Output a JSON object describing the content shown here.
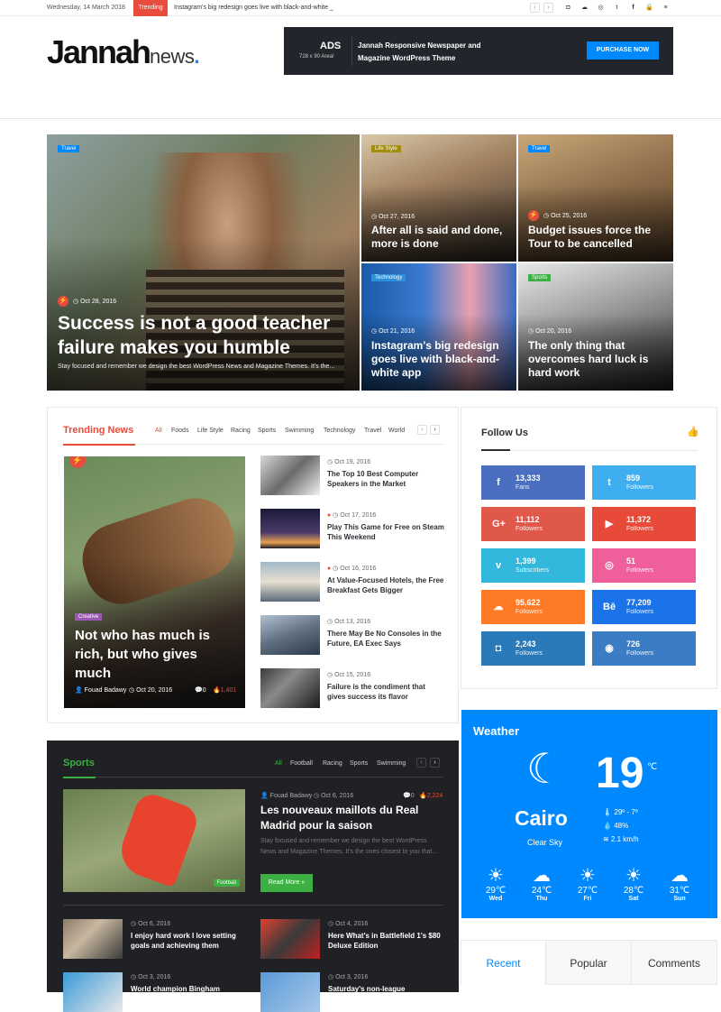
{
  "topbar": {
    "date": "Wednesday, 14 March 2018",
    "trending_label": "Trending",
    "ticker": "Instagram's big redesign goes live with black-and-white _",
    "prev": "‹",
    "next": "›"
  },
  "header": {
    "logo_main": "Jannah",
    "logo_news": "news",
    "logo_dot": ".",
    "ad": {
      "ads": "ADS",
      "size": "728 x 90 Area!",
      "text": "Jannah Responsive Newspaper and Magazine WordPress Theme",
      "button": "PURCHASE NOW"
    }
  },
  "hero": {
    "main": {
      "category": "Travel",
      "date": "Oct 28, 2016",
      "title": "Success is not a good teacher failure makes you humble",
      "excerpt": "Stay focused and remember we design the best WordPress News and Magazine Themes. It's the..."
    },
    "tiles": [
      {
        "category": "Life Style",
        "date": "Oct 27, 2016",
        "title": "After all is said and done, more is done"
      },
      {
        "category": "Travel",
        "date": "Oct 25, 2016",
        "title": "Budget issues force the Tour to be cancelled"
      },
      {
        "category": "Technology",
        "date": "Oct 21, 2016",
        "title": "Instagram's big redesign goes live with black-and-white app"
      },
      {
        "category": "Sports",
        "date": "Oct 20, 2016",
        "title": "The only thing that overcomes hard luck is hard work"
      }
    ]
  },
  "trending": {
    "title": "Trending News",
    "tabs": [
      "All",
      "Foods",
      "Life Style",
      "Racing",
      "Sports",
      "Swimming",
      "Technology",
      "Travel",
      "World"
    ],
    "featured": {
      "category": "Creative",
      "title": "Not who has much is rich, but who gives much",
      "author": "Fouad Badawy",
      "date": "Oct 20, 2016",
      "comments": "0",
      "views": "1,401"
    },
    "items": [
      {
        "date": "Oct 19, 2016",
        "title": "The Top 10 Best Computer Speakers in the Market"
      },
      {
        "date": "Oct 17, 2016",
        "title": "Play This Game for Free on Steam This Weekend"
      },
      {
        "date": "Oct 16, 2016",
        "title": "At Value-Focused Hotels, the Free Breakfast Gets Bigger"
      },
      {
        "date": "Oct 13, 2016",
        "title": "There May Be No Consoles in the Future, EA Exec Says"
      },
      {
        "date": "Oct 15, 2016",
        "title": "Failure is the condiment that gives success its flavor"
      }
    ]
  },
  "follow": {
    "title": "Follow Us",
    "networks": [
      {
        "icon": "f",
        "name": "facebook-icon",
        "count": "13,333",
        "label": "Fans",
        "color": "#4a6fc0"
      },
      {
        "icon": "t",
        "name": "twitter-icon",
        "count": "859",
        "label": "Followers",
        "color": "#3eaef0"
      },
      {
        "icon": "G+",
        "name": "google-plus-icon",
        "count": "11,112",
        "label": "Followers",
        "color": "#e0584a"
      },
      {
        "icon": "▶",
        "name": "youtube-icon",
        "count": "11,372",
        "label": "Followers",
        "color": "#e84a3a"
      },
      {
        "icon": "v",
        "name": "vimeo-icon",
        "count": "1,399",
        "label": "Subscribers",
        "color": "#32b8dc"
      },
      {
        "icon": "◎",
        "name": "dribbble-icon",
        "count": "51",
        "label": "Followers",
        "color": "#ef5f9c"
      },
      {
        "icon": "☁",
        "name": "soundcloud-icon",
        "count": "95,622",
        "label": "Followers",
        "color": "#ff7a26"
      },
      {
        "icon": "Bē",
        "name": "behance-icon",
        "count": "77,209",
        "label": "Followers",
        "color": "#1a73e8"
      },
      {
        "icon": "◘",
        "name": "instagram-icon",
        "count": "2,243",
        "label": "Followers",
        "color": "#2a79b8"
      },
      {
        "icon": "◉",
        "name": "github-icon",
        "count": "726",
        "label": "Followers",
        "color": "#3b7dc4"
      }
    ]
  },
  "weather": {
    "title": "Weather",
    "temp": "19",
    "unit": "℃",
    "range": "29º - 7º",
    "humidity": "48%",
    "wind": "2.1 km/h",
    "city": "Cairo",
    "desc": "Clear Sky",
    "forecast": [
      {
        "temp": "29℃",
        "day": "Wed",
        "icon": "☀"
      },
      {
        "temp": "24℃",
        "day": "Thu",
        "icon": "☁"
      },
      {
        "temp": "27℃",
        "day": "Fri",
        "icon": "☀"
      },
      {
        "temp": "28℃",
        "day": "Sat",
        "icon": "☀"
      },
      {
        "temp": "31℃",
        "day": "Sun",
        "icon": "☁"
      }
    ]
  },
  "sports": {
    "title": "Sports",
    "tabs": [
      "All",
      "Football",
      "Racing",
      "Sports",
      "Swimming"
    ],
    "featured": {
      "author": "Fouad Badawy",
      "date": "Oct 6, 2016",
      "comments": "0",
      "views": "2,224",
      "title": "Les nouveaux maillots du Real Madrid pour la saison",
      "excerpt": "Stay focused and remember we design the best WordPress News and Magazine Themes. It's the ones closest to you that...",
      "category": "Football",
      "read_more": "Read More »"
    },
    "items": [
      {
        "date": "Oct 6, 2016",
        "title": "I enjoy hard work I love setting goals and achieving them"
      },
      {
        "date": "Oct 4, 2016",
        "title": "Here What's in Battlefield 1's $80 Deluxe Edition"
      },
      {
        "date": "Oct 3, 2016",
        "title": "World champion Bingham"
      },
      {
        "date": "Oct 3, 2016",
        "title": "Saturday's non-league"
      }
    ]
  },
  "recent_tabs": [
    "Recent",
    "Popular",
    "Comments"
  ]
}
